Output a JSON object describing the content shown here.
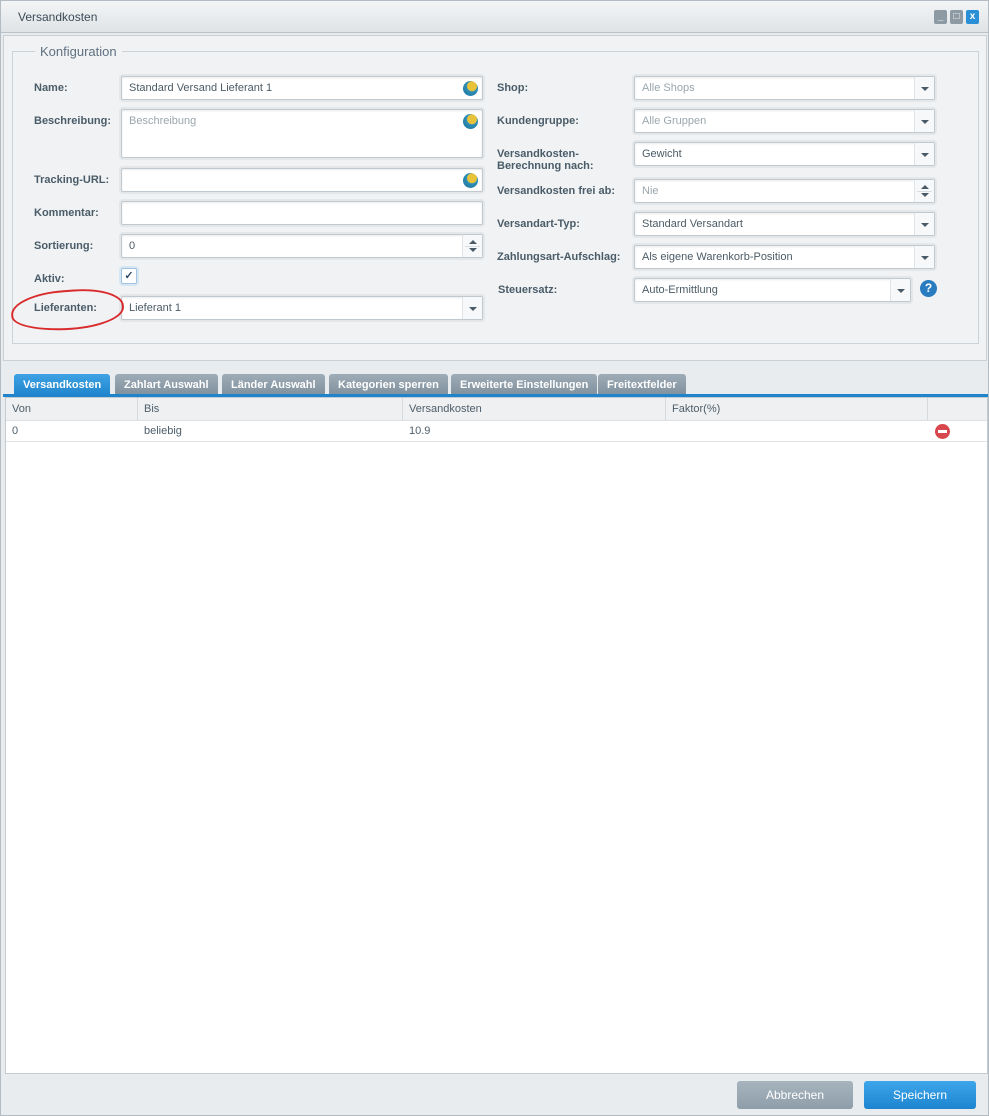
{
  "window": {
    "title": "Versandkosten",
    "controls": [
      "minimize",
      "maximize",
      "close"
    ]
  },
  "config": {
    "legend": "Konfiguration",
    "left": {
      "name": {
        "label": "Name:",
        "value": "Standard Versand Lieferant 1",
        "icon": "globe-icon"
      },
      "description": {
        "label": "Beschreibung:",
        "placeholder": "Beschreibung",
        "icon": "globe-icon"
      },
      "tracking_url": {
        "label": "Tracking-URL:",
        "value": "",
        "icon": "globe-icon"
      },
      "comment": {
        "label": "Kommentar:",
        "value": ""
      },
      "sorting": {
        "label": "Sortierung:",
        "value": "0"
      },
      "active": {
        "label": "Aktiv:",
        "checked": true,
        "check_glyph": "✓"
      },
      "suppliers": {
        "label": "Lieferanten:",
        "value": "Lieferant 1"
      }
    },
    "right": {
      "shop": {
        "label": "Shop:",
        "placeholder": "Alle Shops"
      },
      "customer_group": {
        "label": "Kundengruppe:",
        "placeholder": "Alle Gruppen"
      },
      "calc_by": {
        "label_line1": "Versandkosten-",
        "label_line2": "Berechnung nach:",
        "value": "Gewicht"
      },
      "free_from": {
        "label": "Versandkosten frei ab:",
        "placeholder": "Nie"
      },
      "dispatch_type": {
        "label": "Versandart-Typ:",
        "value": "Standard Versandart"
      },
      "payment_surcharge": {
        "label": "Zahlungsart-Aufschlag:",
        "value": "Als eigene Warenkorb-Position"
      },
      "tax_rate": {
        "label": "Steuersatz:",
        "value": "Auto-Ermittlung",
        "help_glyph": "?"
      }
    }
  },
  "tabs": [
    {
      "label": "Versandkosten",
      "active": true
    },
    {
      "label": "Zahlart Auswahl",
      "active": false
    },
    {
      "label": "Länder Auswahl",
      "active": false
    },
    {
      "label": "Kategorien sperren",
      "active": false
    },
    {
      "label": "Erweiterte Einstellungen",
      "active": false
    },
    {
      "label": "Freitextfelder",
      "active": false
    }
  ],
  "grid": {
    "columns": [
      "Von",
      "Bis",
      "Versandkosten",
      "Faktor(%)",
      ""
    ],
    "rows": [
      {
        "von": "0",
        "bis": "beliebig",
        "versandkosten": "10.9",
        "faktor": "",
        "action": "delete-icon"
      }
    ]
  },
  "footer": {
    "cancel_label": "Abbrechen",
    "save_label": "Speichern"
  },
  "colors": {
    "accent": "#1f84cc",
    "annotation": "#d92b2b",
    "delete": "#d8474d"
  }
}
